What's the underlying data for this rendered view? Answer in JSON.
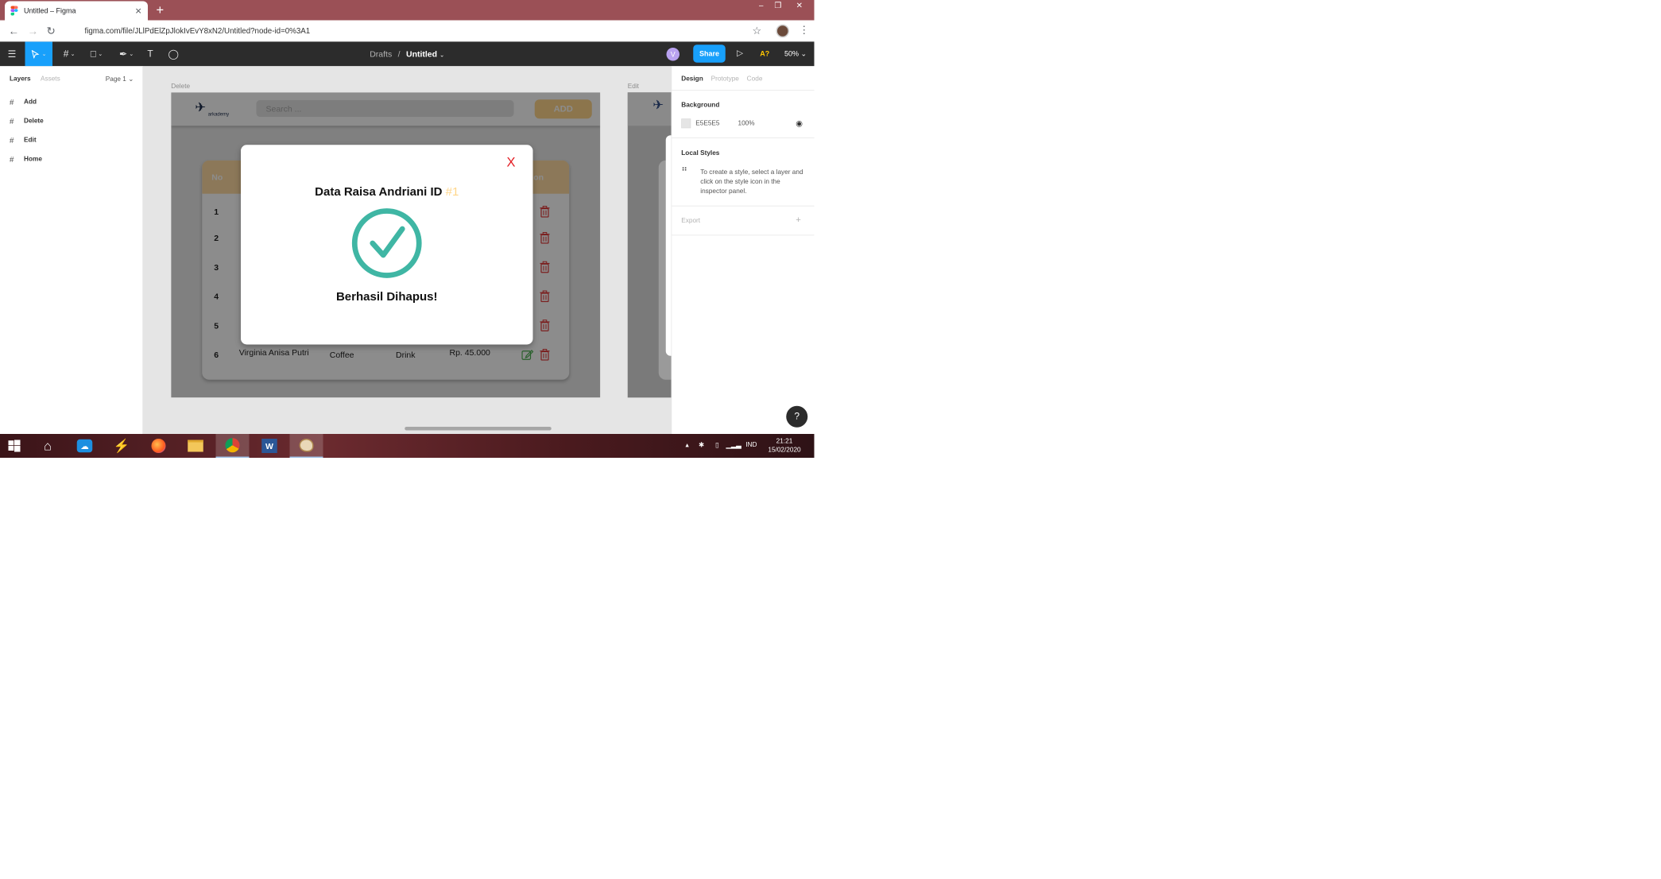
{
  "browser": {
    "tab_title": "Untitled – Figma",
    "tab_close": "✕",
    "new_tab": "+",
    "url": "figma.com/file/JLlPdElZpJlokIvEvY8xN2/Untitled?node-id=0%3A1",
    "window_min": "–",
    "window_restore": "❐",
    "window_close": "✕"
  },
  "toolbar": {
    "breadcrumb_drafts": "Drafts",
    "breadcrumb_sep": "/",
    "file_name": "Untitled",
    "avatar_initial": "V",
    "share_label": "Share",
    "a7_label": "A?",
    "zoom_label": "50%"
  },
  "left_panel": {
    "tab_layers": "Layers",
    "tab_assets": "Assets",
    "page_selector": "Page 1",
    "layers": [
      {
        "label": "Add"
      },
      {
        "label": "Delete"
      },
      {
        "label": "Edit"
      },
      {
        "label": "Home"
      }
    ]
  },
  "canvas": {
    "frame1_label": "Delete",
    "frame2_label": "Edit",
    "design": {
      "logo_text": "arkademy",
      "search_placeholder": "Search ...",
      "add_button": "ADD",
      "table_header": {
        "no": "No",
        "action": "on"
      },
      "rows": [
        {
          "no": "1"
        },
        {
          "no": "2"
        },
        {
          "no": "3"
        },
        {
          "no": "4"
        },
        {
          "no": "5"
        },
        {
          "no": "6",
          "name": "Virginia Anisa Putri",
          "product": "Coffee",
          "category": "Drink",
          "price": "Rp. 45.000"
        }
      ],
      "modal": {
        "close": "X",
        "title": "Data Raisa Andriani ID",
        "title_id": "#1",
        "message": "Berhasil Dihapus!"
      }
    }
  },
  "right_panel": {
    "tab_design": "Design",
    "tab_prototype": "Prototype",
    "tab_code": "Code",
    "background_heading": "Background",
    "background_hex": "E5E5E5",
    "background_opacity": "100%",
    "local_styles_heading": "Local Styles",
    "local_styles_desc": "To create a style, select a layer and click on the style icon in the inspector panel.",
    "export_heading": "Export",
    "help": "?"
  },
  "taskbar": {
    "tray_lang": "IND",
    "time": "21:21",
    "date": "15/02/2020"
  },
  "colors": {
    "figma_blue": "#18a0fb",
    "accent_yellow": "#ffd68a",
    "check_green": "#3fb6a4",
    "close_red": "#e31e24"
  }
}
